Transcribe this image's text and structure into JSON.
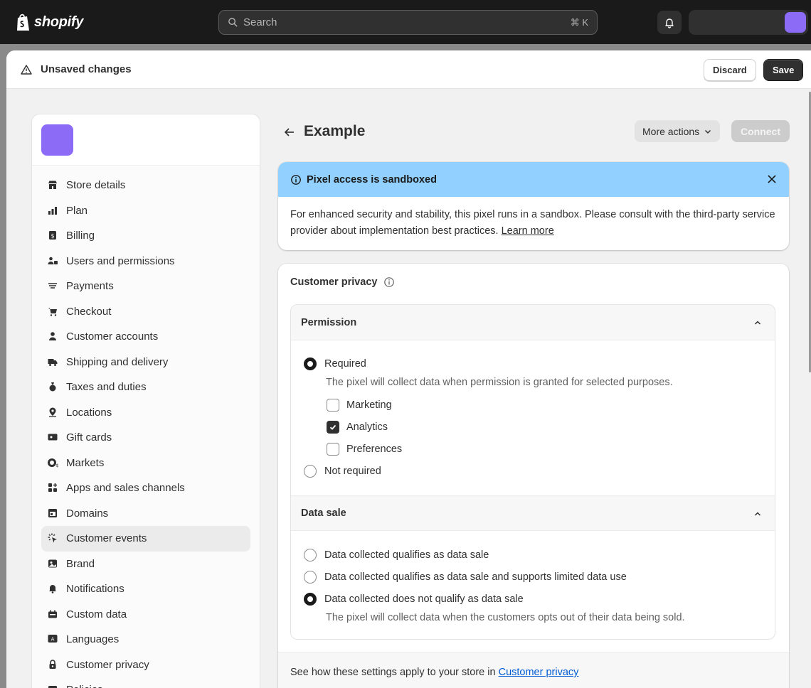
{
  "brand": {
    "name": "shopify"
  },
  "search": {
    "placeholder": "Search",
    "shortcut": "⌘ K"
  },
  "unsaved": {
    "title": "Unsaved changes",
    "discard_label": "Discard",
    "save_label": "Save"
  },
  "sidebar": {
    "items": [
      {
        "label": "Store details",
        "icon": "store-icon"
      },
      {
        "label": "Plan",
        "icon": "plan-icon"
      },
      {
        "label": "Billing",
        "icon": "billing-icon"
      },
      {
        "label": "Users and permissions",
        "icon": "users-icon"
      },
      {
        "label": "Payments",
        "icon": "payments-icon"
      },
      {
        "label": "Checkout",
        "icon": "cart-icon"
      },
      {
        "label": "Customer accounts",
        "icon": "person-icon"
      },
      {
        "label": "Shipping and delivery",
        "icon": "truck-icon"
      },
      {
        "label": "Taxes and duties",
        "icon": "tax-icon"
      },
      {
        "label": "Locations",
        "icon": "location-icon"
      },
      {
        "label": "Gift cards",
        "icon": "gift-card-icon"
      },
      {
        "label": "Markets",
        "icon": "globe-icon"
      },
      {
        "label": "Apps and sales channels",
        "icon": "apps-icon"
      },
      {
        "label": "Domains",
        "icon": "domains-icon"
      },
      {
        "label": "Customer events",
        "icon": "cursor-icon",
        "active": true
      },
      {
        "label": "Brand",
        "icon": "brand-icon"
      },
      {
        "label": "Notifications",
        "icon": "bell-icon"
      },
      {
        "label": "Custom data",
        "icon": "custom-data-icon"
      },
      {
        "label": "Languages",
        "icon": "languages-icon"
      },
      {
        "label": "Customer privacy",
        "icon": "lock-icon"
      },
      {
        "label": "Policies",
        "icon": "policies-icon"
      }
    ]
  },
  "page": {
    "title": "Example",
    "more_actions_label": "More actions",
    "connect_label": "Connect"
  },
  "banner": {
    "title": "Pixel access is sandboxed",
    "body": "For enhanced security and stability, this pixel runs in a sandbox. Please consult with the third-party service provider about implementation best practices.",
    "link": "Learn more"
  },
  "privacy": {
    "title": "Customer privacy",
    "permission": {
      "heading": "Permission",
      "required_label": "Required",
      "required_hint": "The pixel will collect data when permission is granted for selected purposes.",
      "purposes": [
        {
          "label": "Marketing",
          "checked": false
        },
        {
          "label": "Analytics",
          "checked": true
        },
        {
          "label": "Preferences",
          "checked": false
        }
      ],
      "not_required_label": "Not required",
      "selected": "Required"
    },
    "data_sale": {
      "heading": "Data sale",
      "options": [
        "Data collected qualifies as data sale",
        "Data collected qualifies as data sale and supports limited data use",
        "Data collected does not qualify as data sale"
      ],
      "selected": "Data collected does not qualify as data sale",
      "hint": "The pixel will collect data when the customers opts out of their data being sold."
    },
    "footer_text": "See how these settings apply to your store in",
    "footer_link": "Customer privacy"
  },
  "colors": {
    "accent": "#8c6cf7",
    "banner": "#91d0ff",
    "topbar": "#1a1a1a",
    "link": "#005bd3"
  }
}
